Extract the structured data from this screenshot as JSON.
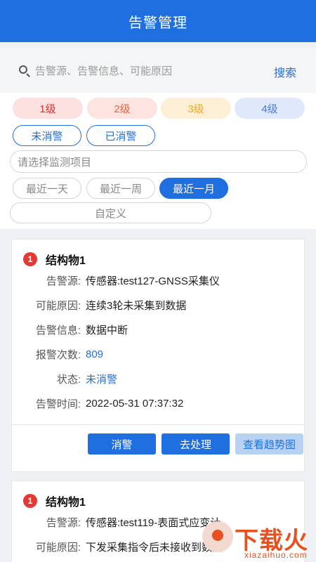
{
  "header": {
    "title": "告警管理"
  },
  "search": {
    "placeholder": "告警源、告警信息、可能原因",
    "button_label": "搜索"
  },
  "levels": [
    "1级",
    "2级",
    "3级",
    "4级"
  ],
  "status_filters": [
    "未消警",
    "已消警"
  ],
  "project_select": {
    "placeholder": "请选择监测项目"
  },
  "time_filters": [
    "最近一天",
    "最近一周",
    "最近一月"
  ],
  "time_selected": "最近一月",
  "custom_label": "自定义",
  "colors": {
    "primary": "#1f6fe0",
    "alert_badge": "#e53935",
    "level1": "#e02b2b",
    "level2": "#e8643c",
    "level3": "#f0a820",
    "level4": "#4a7ad8"
  },
  "cards": [
    {
      "badge": "1",
      "title": "结构物1",
      "fields": [
        {
          "label": "告警源:",
          "value": "传感器:test127-GNSS采集仪"
        },
        {
          "label": "可能原因:",
          "value": "连续3轮未采集到数据"
        },
        {
          "label": "告警信息:",
          "value": "数据中断"
        },
        {
          "label": "报警次数:",
          "value": "809"
        },
        {
          "label": "状态:",
          "value": "未消警"
        },
        {
          "label": "告警时间:",
          "value": "2022-05-31 07:37:32"
        }
      ],
      "actions": [
        "消警",
        "去处理",
        "查看趋势图"
      ]
    },
    {
      "badge": "1",
      "title": "结构物1",
      "fields": [
        {
          "label": "告警源:",
          "value": "传感器:test119-表面式应变计"
        },
        {
          "label": "可能原因:",
          "value": "下发采集指令后未接收到数据"
        }
      ]
    }
  ],
  "watermark": {
    "text": "下载火",
    "url": "xiazaihuo.com"
  }
}
